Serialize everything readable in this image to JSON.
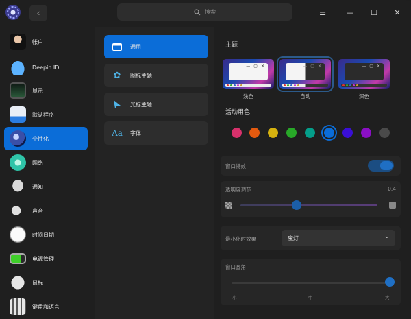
{
  "search": {
    "placeholder": "搜索"
  },
  "sidebar": {
    "items": [
      {
        "label": "帐户",
        "icon": "account-icon"
      },
      {
        "label": "Deepin ID",
        "icon": "cloud-icon"
      },
      {
        "label": "显示",
        "icon": "display-icon"
      },
      {
        "label": "默认程序",
        "icon": "default-apps-icon"
      },
      {
        "label": "个性化",
        "icon": "personalization-icon",
        "active": true
      },
      {
        "label": "网络",
        "icon": "network-icon"
      },
      {
        "label": "通知",
        "icon": "bell-icon"
      },
      {
        "label": "声音",
        "icon": "speaker-icon"
      },
      {
        "label": "时间日期",
        "icon": "clock-icon"
      },
      {
        "label": "电源管理",
        "icon": "battery-icon"
      },
      {
        "label": "鼠标",
        "icon": "mouse-icon"
      },
      {
        "label": "键盘和语言",
        "icon": "keyboard-icon"
      }
    ]
  },
  "middle": {
    "items": [
      {
        "label": "通用",
        "icon": "window-icon",
        "active": true
      },
      {
        "label": "图标主题",
        "icon": "icon-theme-icon"
      },
      {
        "label": "光标主题",
        "icon": "cursor-icon"
      },
      {
        "label": "字体",
        "icon": "font-icon"
      }
    ]
  },
  "theme": {
    "title": "主题",
    "options": [
      {
        "label": "浅色"
      },
      {
        "label": "自动",
        "selected": true
      },
      {
        "label": "深色"
      }
    ]
  },
  "accent": {
    "title": "活动用色",
    "colors": [
      "#d8316c",
      "#e35a0f",
      "#d6b20f",
      "#28a828",
      "#049e8a",
      "#0b6dd8",
      "#3a0fd6",
      "#8a0fc4",
      "#4a4a4a"
    ],
    "selected_index": 5
  },
  "window_effect": {
    "label": "窗口特效",
    "enabled": true
  },
  "transparency": {
    "label": "透明度调节",
    "value_text": "0.4",
    "value": 0.4
  },
  "minimize_effect": {
    "label": "最小化时效果",
    "value": "魔灯"
  },
  "corner": {
    "label": "窗口圆角",
    "ticks": [
      "小",
      "中",
      "大"
    ],
    "value": 1.0
  }
}
